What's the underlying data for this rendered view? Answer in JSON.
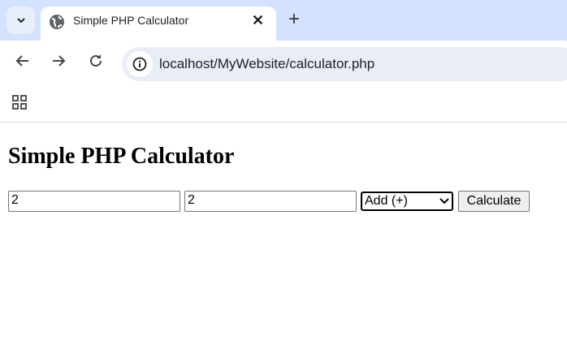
{
  "browser": {
    "tab_title": "Simple PHP Calculator",
    "url": "localhost/MyWebsite/calculator.php",
    "new_tab": "+",
    "close": "✕"
  },
  "page": {
    "heading": "Simple PHP Calculator",
    "num1": "2",
    "num2": "2",
    "operation": "Add (+)",
    "submit_label": "Calculate"
  }
}
